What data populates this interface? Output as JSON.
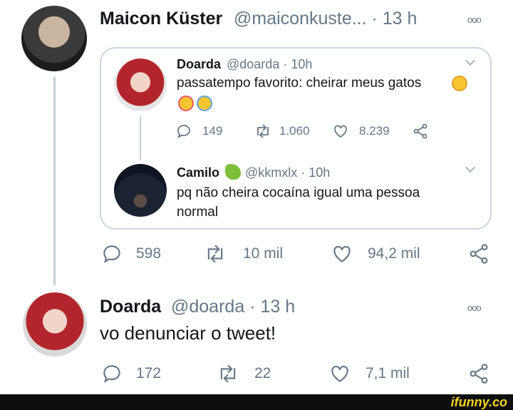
{
  "main_tweet": {
    "author_name": "Maicon Küster",
    "handle_time": "@maiconkuste... · 13 h",
    "more": "ooo"
  },
  "quoted_tweet": {
    "author_name": "Doarda",
    "handle_time": "@doarda · 10h",
    "text": "passatempo favorito: cheirar meus gatos",
    "replies": "149",
    "retweets": "1.060",
    "likes": "8.239"
  },
  "quoted_reply": {
    "author_name": "Camilo",
    "handle_time": "@kkmxlx · 10h",
    "text_line1": "pq não cheira cocaína igual uma pessoa",
    "text_line2": "normal"
  },
  "main_actions": {
    "replies": "598",
    "retweets": "10 mil",
    "likes": "94,2 mil"
  },
  "reply_tweet": {
    "author_name": "Doarda",
    "handle_time": "@doarda · 13 h",
    "text": "vo denunciar o tweet!",
    "more": "ooo",
    "replies": "172",
    "retweets": "22",
    "likes": "7,1 mil"
  },
  "watermark": "ifunny.co",
  "colors": {
    "muted": "#657786",
    "border": "#ccd6dd",
    "thread_line": "#c4cfd6",
    "watermark": "#f5d11e"
  }
}
